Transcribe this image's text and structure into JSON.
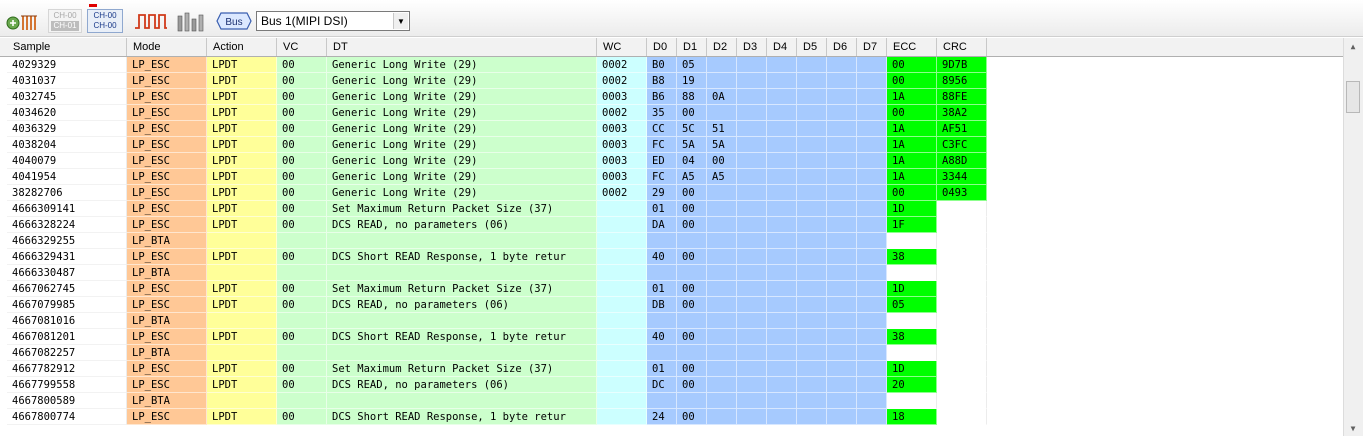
{
  "toolbar": {
    "ch_button_1": {
      "line1": "CH-00",
      "line2": "CH-01"
    },
    "ch_button_2": {
      "line1": "CH-00",
      "line2": "CH-00"
    },
    "bus_icon_label": "Bus",
    "bus_select": {
      "value": "Bus 1(MIPI DSI)"
    }
  },
  "table": {
    "columns": [
      {
        "key": "sample",
        "label": "Sample"
      },
      {
        "key": "mode",
        "label": "Mode"
      },
      {
        "key": "action",
        "label": "Action"
      },
      {
        "key": "vc",
        "label": "VC"
      },
      {
        "key": "dt",
        "label": "DT"
      },
      {
        "key": "wc",
        "label": "WC"
      },
      {
        "key": "d0",
        "label": "D0"
      },
      {
        "key": "d1",
        "label": "D1"
      },
      {
        "key": "d2",
        "label": "D2"
      },
      {
        "key": "d3",
        "label": "D3"
      },
      {
        "key": "d4",
        "label": "D4"
      },
      {
        "key": "d5",
        "label": "D5"
      },
      {
        "key": "d6",
        "label": "D6"
      },
      {
        "key": "d7",
        "label": "D7"
      },
      {
        "key": "ecc",
        "label": "ECC"
      },
      {
        "key": "crc",
        "label": "CRC"
      }
    ],
    "rows": [
      {
        "sample": "4029329",
        "mode": "LP_ESC",
        "action": "LPDT",
        "vc": "00",
        "dt": "Generic Long Write (29)",
        "wc": "0002",
        "d": [
          "B0",
          "05",
          "",
          "",
          "",
          "",
          "",
          ""
        ],
        "ecc": "00",
        "crc": "9D7B"
      },
      {
        "sample": "4031037",
        "mode": "LP_ESC",
        "action": "LPDT",
        "vc": "00",
        "dt": "Generic Long Write (29)",
        "wc": "0002",
        "d": [
          "B8",
          "19",
          "",
          "",
          "",
          "",
          "",
          ""
        ],
        "ecc": "00",
        "crc": "8956"
      },
      {
        "sample": "4032745",
        "mode": "LP_ESC",
        "action": "LPDT",
        "vc": "00",
        "dt": "Generic Long Write (29)",
        "wc": "0003",
        "d": [
          "B6",
          "88",
          "0A",
          "",
          "",
          "",
          "",
          ""
        ],
        "ecc": "1A",
        "crc": "88FE"
      },
      {
        "sample": "4034620",
        "mode": "LP_ESC",
        "action": "LPDT",
        "vc": "00",
        "dt": "Generic Long Write (29)",
        "wc": "0002",
        "d": [
          "35",
          "00",
          "",
          "",
          "",
          "",
          "",
          ""
        ],
        "ecc": "00",
        "crc": "38A2"
      },
      {
        "sample": "4036329",
        "mode": "LP_ESC",
        "action": "LPDT",
        "vc": "00",
        "dt": "Generic Long Write (29)",
        "wc": "0003",
        "d": [
          "CC",
          "5C",
          "51",
          "",
          "",
          "",
          "",
          ""
        ],
        "ecc": "1A",
        "crc": "AF51"
      },
      {
        "sample": "4038204",
        "mode": "LP_ESC",
        "action": "LPDT",
        "vc": "00",
        "dt": "Generic Long Write (29)",
        "wc": "0003",
        "d": [
          "FC",
          "5A",
          "5A",
          "",
          "",
          "",
          "",
          ""
        ],
        "ecc": "1A",
        "crc": "C3FC"
      },
      {
        "sample": "4040079",
        "mode": "LP_ESC",
        "action": "LPDT",
        "vc": "00",
        "dt": "Generic Long Write (29)",
        "wc": "0003",
        "d": [
          "ED",
          "04",
          "00",
          "",
          "",
          "",
          "",
          ""
        ],
        "ecc": "1A",
        "crc": "A88D"
      },
      {
        "sample": "4041954",
        "mode": "LP_ESC",
        "action": "LPDT",
        "vc": "00",
        "dt": "Generic Long Write (29)",
        "wc": "0003",
        "d": [
          "FC",
          "A5",
          "A5",
          "",
          "",
          "",
          "",
          ""
        ],
        "ecc": "1A",
        "crc": "3344"
      },
      {
        "sample": "38282706",
        "mode": "LP_ESC",
        "action": "LPDT",
        "vc": "00",
        "dt": "Generic Long Write (29)",
        "wc": "0002",
        "d": [
          "29",
          "00",
          "",
          "",
          "",
          "",
          "",
          ""
        ],
        "ecc": "00",
        "crc": "0493"
      },
      {
        "sample": "4666309141",
        "mode": "LP_ESC",
        "action": "LPDT",
        "vc": "00",
        "dt": "Set Maximum Return Packet Size (37)",
        "wc": "",
        "d": [
          "01",
          "00",
          "",
          "",
          "",
          "",
          "",
          ""
        ],
        "ecc": "1D",
        "crc": ""
      },
      {
        "sample": "4666328224",
        "mode": "LP_ESC",
        "action": "LPDT",
        "vc": "00",
        "dt": "DCS READ, no parameters (06)",
        "wc": "",
        "d": [
          "DA",
          "00",
          "",
          "",
          "",
          "",
          "",
          ""
        ],
        "ecc": "1F",
        "crc": ""
      },
      {
        "sample": "4666329255",
        "mode": "LP_BTA",
        "action": "",
        "vc": "",
        "dt": "",
        "wc": "",
        "d": [
          "",
          "",
          "",
          "",
          "",
          "",
          "",
          ""
        ],
        "ecc": "",
        "crc": ""
      },
      {
        "sample": "4666329431",
        "mode": "LP_ESC",
        "action": "LPDT",
        "vc": "00",
        "dt": "DCS Short READ Response, 1 byte retur",
        "wc": "",
        "d": [
          "40",
          "00",
          "",
          "",
          "",
          "",
          "",
          ""
        ],
        "ecc": "38",
        "crc": ""
      },
      {
        "sample": "4666330487",
        "mode": "LP_BTA",
        "action": "",
        "vc": "",
        "dt": "",
        "wc": "",
        "d": [
          "",
          "",
          "",
          "",
          "",
          "",
          "",
          ""
        ],
        "ecc": "",
        "crc": ""
      },
      {
        "sample": "4667062745",
        "mode": "LP_ESC",
        "action": "LPDT",
        "vc": "00",
        "dt": "Set Maximum Return Packet Size (37)",
        "wc": "",
        "d": [
          "01",
          "00",
          "",
          "",
          "",
          "",
          "",
          ""
        ],
        "ecc": "1D",
        "crc": ""
      },
      {
        "sample": "4667079985",
        "mode": "LP_ESC",
        "action": "LPDT",
        "vc": "00",
        "dt": "DCS READ, no parameters (06)",
        "wc": "",
        "d": [
          "DB",
          "00",
          "",
          "",
          "",
          "",
          "",
          ""
        ],
        "ecc": "05",
        "crc": ""
      },
      {
        "sample": "4667081016",
        "mode": "LP_BTA",
        "action": "",
        "vc": "",
        "dt": "",
        "wc": "",
        "d": [
          "",
          "",
          "",
          "",
          "",
          "",
          "",
          ""
        ],
        "ecc": "",
        "crc": ""
      },
      {
        "sample": "4667081201",
        "mode": "LP_ESC",
        "action": "LPDT",
        "vc": "00",
        "dt": "DCS Short READ Response, 1 byte retur",
        "wc": "",
        "d": [
          "40",
          "00",
          "",
          "",
          "",
          "",
          "",
          ""
        ],
        "ecc": "38",
        "crc": ""
      },
      {
        "sample": "4667082257",
        "mode": "LP_BTA",
        "action": "",
        "vc": "",
        "dt": "",
        "wc": "",
        "d": [
          "",
          "",
          "",
          "",
          "",
          "",
          "",
          ""
        ],
        "ecc": "",
        "crc": ""
      },
      {
        "sample": "4667782912",
        "mode": "LP_ESC",
        "action": "LPDT",
        "vc": "00",
        "dt": "Set Maximum Return Packet Size (37)",
        "wc": "",
        "d": [
          "01",
          "00",
          "",
          "",
          "",
          "",
          "",
          ""
        ],
        "ecc": "1D",
        "crc": ""
      },
      {
        "sample": "4667799558",
        "mode": "LP_ESC",
        "action": "LPDT",
        "vc": "00",
        "dt": "DCS READ, no parameters (06)",
        "wc": "",
        "d": [
          "DC",
          "00",
          "",
          "",
          "",
          "",
          "",
          ""
        ],
        "ecc": "20",
        "crc": ""
      },
      {
        "sample": "4667800589",
        "mode": "LP_BTA",
        "action": "",
        "vc": "",
        "dt": "",
        "wc": "",
        "d": [
          "",
          "",
          "",
          "",
          "",
          "",
          "",
          ""
        ],
        "ecc": "",
        "crc": ""
      },
      {
        "sample": "4667800774",
        "mode": "LP_ESC",
        "action": "LPDT",
        "vc": "00",
        "dt": "DCS Short READ Response, 1 byte retur",
        "wc": "",
        "d": [
          "24",
          "00",
          "",
          "",
          "",
          "",
          "",
          ""
        ],
        "ecc": "18",
        "crc": ""
      }
    ]
  },
  "icons": {
    "toolbar": [
      "settings-wave-icon",
      "channel-select-icon",
      "channel-map-icon",
      "pulse-waveform-icon",
      "bar-graph-icon",
      "bus-decode-icon"
    ],
    "scrollbar": [
      "scroll-up-icon",
      "scroll-down-icon"
    ]
  },
  "colors": {
    "mode": "#ffc896",
    "action": "#ffff99",
    "dt_vc": "#ccffcc",
    "wc": "#ccffff",
    "data_bytes": "#a6cafe",
    "ecc_crc": "#00ff00"
  }
}
